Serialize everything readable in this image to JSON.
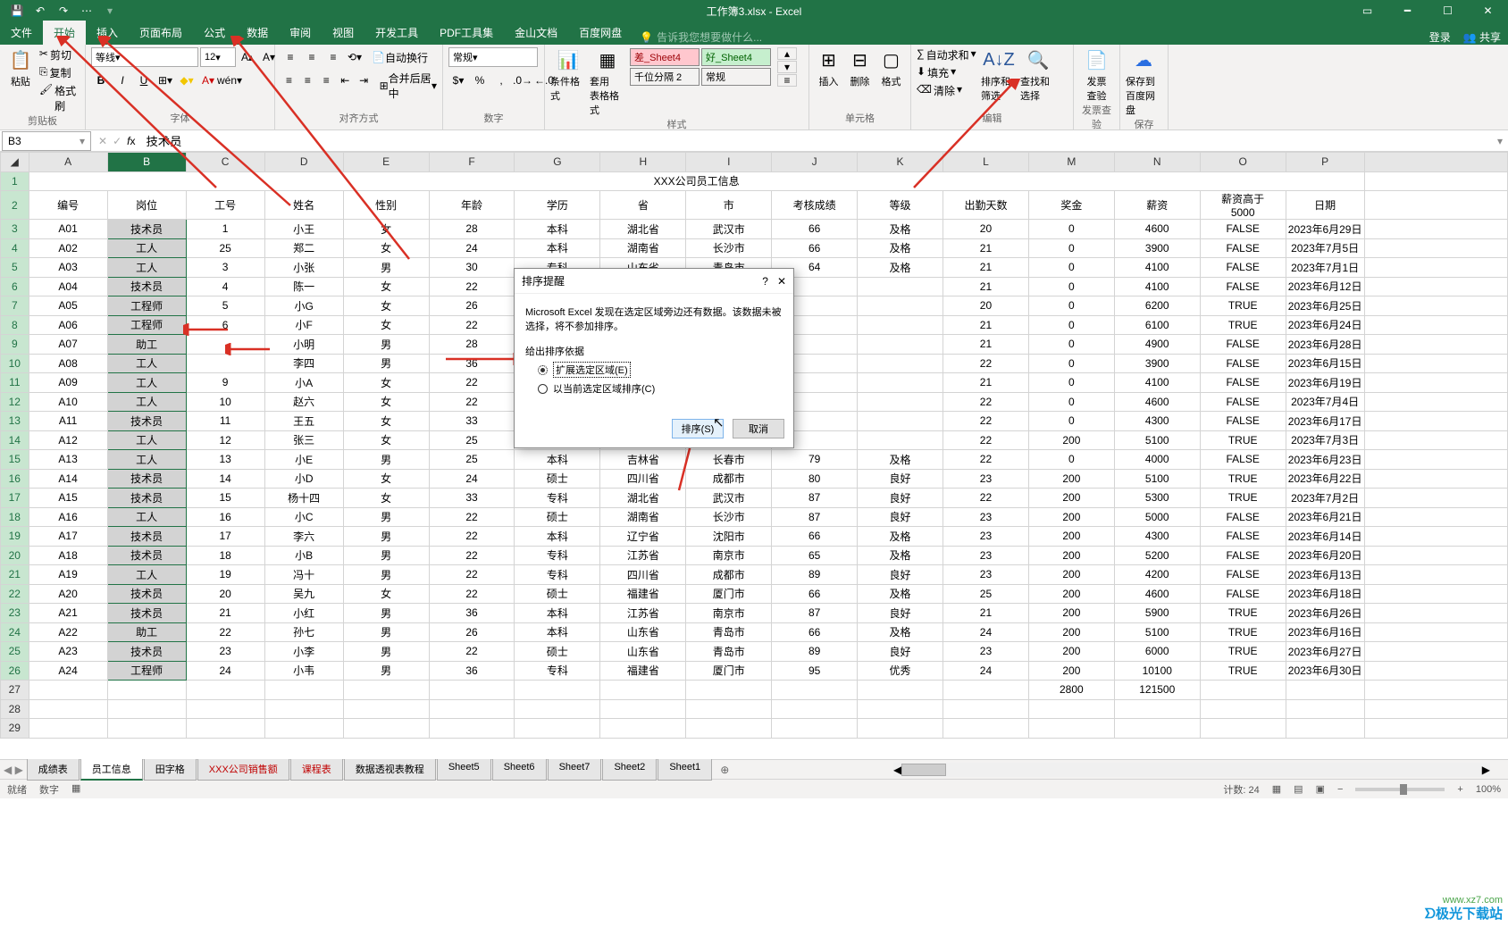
{
  "app": {
    "title": "工作簿3.xlsx - Excel"
  },
  "win": {
    "login": "登录",
    "share": "共享"
  },
  "qat": [
    "save-icon",
    "undo-icon",
    "redo-icon",
    "touch-icon"
  ],
  "menu": {
    "file": "文件",
    "home": "开始",
    "insert": "插入",
    "layout": "页面布局",
    "formula": "公式",
    "data": "数据",
    "review": "审阅",
    "view": "视图",
    "dev": "开发工具",
    "pdf": "PDF工具集",
    "wps": "金山文档",
    "baidu": "百度网盘",
    "tell": "告诉我您想要做什么..."
  },
  "ribbon": {
    "clipboard": {
      "paste": "粘贴",
      "cut": "剪切",
      "copy": "复制",
      "fmtpaint": "格式刷",
      "label": "剪贴板"
    },
    "font": {
      "name": "等线",
      "size": "12",
      "label": "字体"
    },
    "align": {
      "wrap": "自动换行",
      "merge": "合并后居中",
      "label": "对齐方式"
    },
    "number": {
      "fmt": "常规",
      "label": "数字"
    },
    "styles": {
      "cond": "条件格式",
      "tbl": "套用\n表格格式",
      "bad": "差_Sheet4",
      "good": "好_Sheet4",
      "thou": "千位分隔 2",
      "normal": "常规",
      "label": "样式"
    },
    "cells": {
      "ins": "插入",
      "del": "删除",
      "fmt": "格式",
      "label": "单元格"
    },
    "edit": {
      "sum": "自动求和",
      "fill": "填充",
      "clear": "清除",
      "sort": "排序和筛选",
      "find": "查找和选择",
      "label": "编辑"
    },
    "fapiao": {
      "btn": "发票\n查验",
      "label": "发票查验"
    },
    "save": {
      "btn": "保存到\n百度网盘",
      "label": "保存"
    }
  },
  "namebox": {
    "ref": "B3",
    "fx": "技术员"
  },
  "cols": [
    "A",
    "B",
    "C",
    "D",
    "E",
    "F",
    "G",
    "H",
    "I",
    "J",
    "K",
    "L",
    "M",
    "N",
    "O",
    "P"
  ],
  "merged_title": "XXX公司员工信息",
  "headers": [
    "编号",
    "岗位",
    "工号",
    "姓名",
    "性别",
    "年龄",
    "学历",
    "省",
    "市",
    "考核成绩",
    "等级",
    "出勤天数",
    "奖金",
    "薪资",
    "薪资高于\n5000",
    "日期"
  ],
  "rows": [
    [
      "A01",
      "技术员",
      "1",
      "小王",
      "女",
      "28",
      "本科",
      "湖北省",
      "武汉市",
      "66",
      "及格",
      "20",
      "0",
      "4600",
      "FALSE",
      "2023年6月29日"
    ],
    [
      "A02",
      "工人",
      "25",
      "郑二",
      "女",
      "24",
      "本科",
      "湖南省",
      "长沙市",
      "66",
      "及格",
      "21",
      "0",
      "3900",
      "FALSE",
      "2023年7月5日"
    ],
    [
      "A03",
      "工人",
      "3",
      "小张",
      "男",
      "30",
      "专科",
      "山东省",
      "青岛市",
      "64",
      "及格",
      "21",
      "0",
      "4100",
      "FALSE",
      "2023年7月1日"
    ],
    [
      "A04",
      "技术员",
      "4",
      "陈一",
      "女",
      "22",
      "本科",
      "",
      "",
      "",
      "",
      "21",
      "0",
      "4100",
      "FALSE",
      "2023年6月12日"
    ],
    [
      "A05",
      "工程师",
      "5",
      "小G",
      "女",
      "26",
      "硕士",
      "",
      "",
      "",
      "",
      "20",
      "0",
      "6200",
      "TRUE",
      "2023年6月25日"
    ],
    [
      "A06",
      "工程师",
      "6",
      "小F",
      "女",
      "22",
      "专科",
      "",
      "",
      "",
      "",
      "21",
      "0",
      "6100",
      "TRUE",
      "2023年6月24日"
    ],
    [
      "A07",
      "助工",
      "",
      "小明",
      "男",
      "28",
      "本科",
      "",
      "",
      "",
      "",
      "21",
      "0",
      "4900",
      "FALSE",
      "2023年6月28日"
    ],
    [
      "A08",
      "工人",
      "",
      "李四",
      "男",
      "36",
      "本科",
      "",
      "",
      "",
      "",
      "22",
      "0",
      "3900",
      "FALSE",
      "2023年6月15日"
    ],
    [
      "A09",
      "工人",
      "9",
      "小A",
      "女",
      "22",
      "本科",
      "",
      "",
      "",
      "",
      "21",
      "0",
      "4100",
      "FALSE",
      "2023年6月19日"
    ],
    [
      "A10",
      "工人",
      "10",
      "赵六",
      "女",
      "22",
      "本科",
      "",
      "",
      "",
      "",
      "22",
      "0",
      "4600",
      "FALSE",
      "2023年7月4日"
    ],
    [
      "A11",
      "技术员",
      "11",
      "王五",
      "女",
      "33",
      "硕士",
      "",
      "",
      "",
      "",
      "22",
      "0",
      "4300",
      "FALSE",
      "2023年6月17日"
    ],
    [
      "A12",
      "工人",
      "12",
      "张三",
      "女",
      "25",
      "专科",
      "",
      "",
      "",
      "",
      "22",
      "200",
      "5100",
      "TRUE",
      "2023年7月3日"
    ],
    [
      "A13",
      "工人",
      "13",
      "小E",
      "男",
      "25",
      "本科",
      "吉林省",
      "长春市",
      "79",
      "及格",
      "22",
      "0",
      "4000",
      "FALSE",
      "2023年6月23日"
    ],
    [
      "A14",
      "技术员",
      "14",
      "小D",
      "女",
      "24",
      "硕士",
      "四川省",
      "成都市",
      "80",
      "良好",
      "23",
      "200",
      "5100",
      "TRUE",
      "2023年6月22日"
    ],
    [
      "A15",
      "技术员",
      "15",
      "杨十四",
      "女",
      "33",
      "专科",
      "湖北省",
      "武汉市",
      "87",
      "良好",
      "22",
      "200",
      "5300",
      "TRUE",
      "2023年7月2日"
    ],
    [
      "A16",
      "工人",
      "16",
      "小C",
      "男",
      "22",
      "硕士",
      "湖南省",
      "长沙市",
      "87",
      "良好",
      "23",
      "200",
      "5000",
      "FALSE",
      "2023年6月21日"
    ],
    [
      "A17",
      "技术员",
      "17",
      "李六",
      "男",
      "22",
      "本科",
      "辽宁省",
      "沈阳市",
      "66",
      "及格",
      "23",
      "200",
      "4300",
      "FALSE",
      "2023年6月14日"
    ],
    [
      "A18",
      "技术员",
      "18",
      "小B",
      "男",
      "22",
      "专科",
      "江苏省",
      "南京市",
      "65",
      "及格",
      "23",
      "200",
      "5200",
      "FALSE",
      "2023年6月20日"
    ],
    [
      "A19",
      "工人",
      "19",
      "冯十",
      "男",
      "22",
      "专科",
      "四川省",
      "成都市",
      "89",
      "良好",
      "23",
      "200",
      "4200",
      "FALSE",
      "2023年6月13日"
    ],
    [
      "A20",
      "技术员",
      "20",
      "吴九",
      "女",
      "22",
      "硕士",
      "福建省",
      "厦门市",
      "66",
      "及格",
      "25",
      "200",
      "4600",
      "FALSE",
      "2023年6月18日"
    ],
    [
      "A21",
      "技术员",
      "21",
      "小红",
      "男",
      "36",
      "本科",
      "江苏省",
      "南京市",
      "87",
      "良好",
      "21",
      "200",
      "5900",
      "TRUE",
      "2023年6月26日"
    ],
    [
      "A22",
      "助工",
      "22",
      "孙七",
      "男",
      "26",
      "本科",
      "山东省",
      "青岛市",
      "66",
      "及格",
      "24",
      "200",
      "5100",
      "TRUE",
      "2023年6月16日"
    ],
    [
      "A23",
      "技术员",
      "23",
      "小李",
      "男",
      "22",
      "硕士",
      "山东省",
      "青岛市",
      "89",
      "良好",
      "23",
      "200",
      "6000",
      "TRUE",
      "2023年6月27日"
    ],
    [
      "A24",
      "工程师",
      "24",
      "小韦",
      "男",
      "36",
      "专科",
      "福建省",
      "厦门市",
      "95",
      "优秀",
      "24",
      "200",
      "10100",
      "TRUE",
      "2023年6月30日"
    ],
    [
      "",
      "",
      "",
      "",
      "",
      "",
      "",
      "",
      "",
      "",
      "",
      "",
      "2800",
      "121500",
      "",
      "",
      ""
    ]
  ],
  "dialog": {
    "title": "排序提醒",
    "msg": "Microsoft Excel 发现在选定区域旁边还有数据。该数据未被选择，将不参加排序。",
    "section": "给出排序依据",
    "opt1": "扩展选定区域(E)",
    "opt2": "以当前选定区域排序(C)",
    "ok": "排序(S)",
    "cancel": "取消"
  },
  "tabs": {
    "nav": [
      "⏮",
      "◀",
      "▶",
      "⏭"
    ],
    "list": [
      "成绩表",
      "员工信息",
      "田字格",
      "XXX公司销售额",
      "课程表",
      "数据透视表教程",
      "Sheet5",
      "Sheet6",
      "Sheet7",
      "Sheet2",
      "Sheet1"
    ],
    "active": "员工信息",
    "add": "⊕"
  },
  "status": {
    "left_ready": "就绪",
    "left_mode": "数字",
    "filter": "",
    "right": "计数: 24",
    "zoom": "100%",
    "plus": "+",
    "minus": "−"
  }
}
